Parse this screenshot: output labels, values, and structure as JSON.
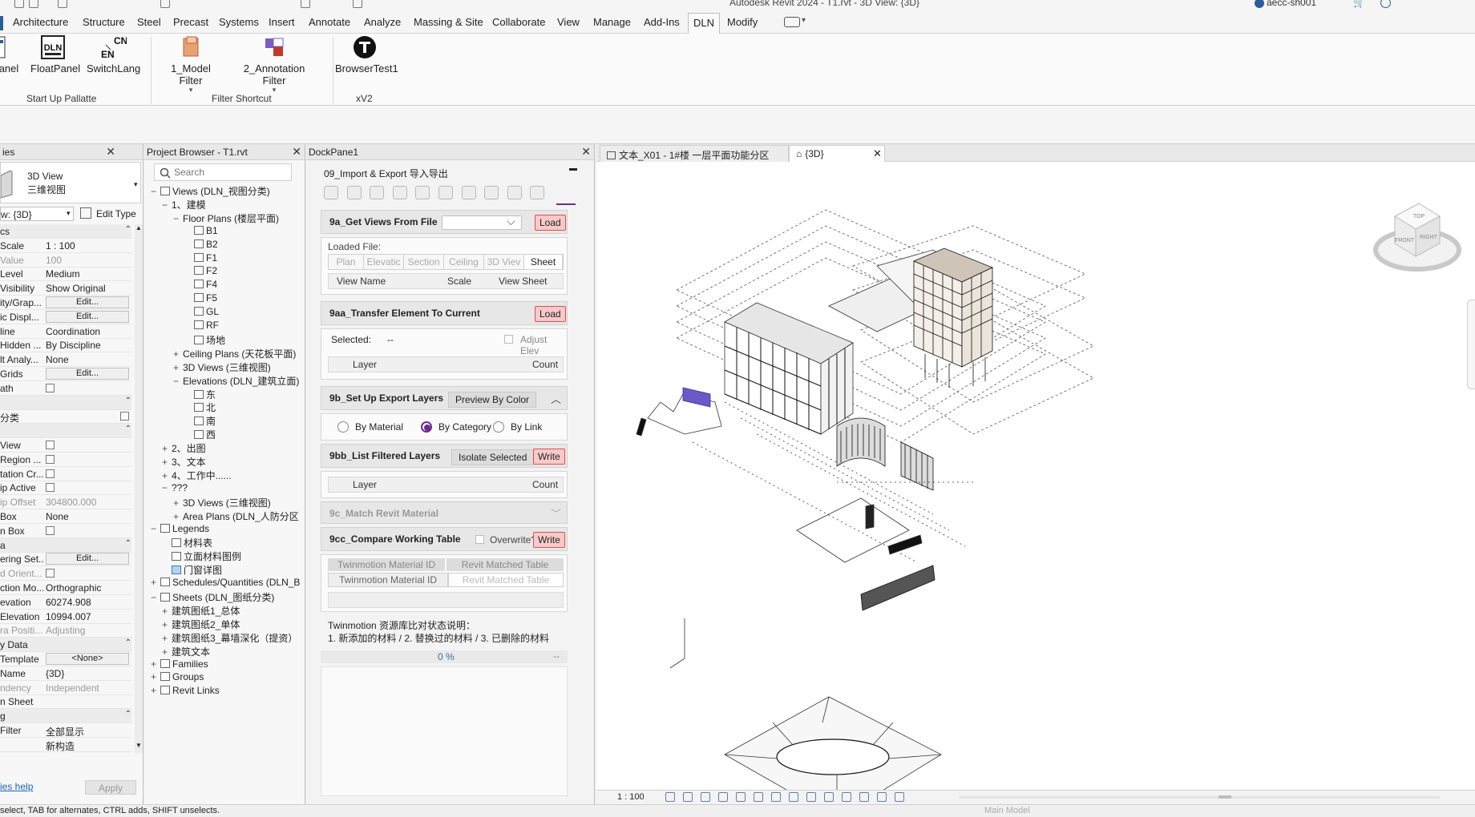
{
  "window": {
    "title": "Autodesk Revit 2024 - T1.rvt - 3D View: {3D}",
    "user": "aecc-sh001"
  },
  "ribbon_tabs": [
    "Architecture",
    "Structure",
    "Steel",
    "Precast",
    "Systems",
    "Insert",
    "Annotate",
    "Analyze",
    "Massing & Site",
    "Collaborate",
    "View",
    "Manage",
    "Add-Ins",
    "DLN",
    "Modify"
  ],
  "active_tab": "DLN",
  "ribbon": {
    "buttons": {
      "panel": "anel",
      "float_panel": "FloatPanel",
      "switch_lang": "SwitchLang",
      "model_filter": "1_Model Filter",
      "annotation_filter": "2_Annotation Filter",
      "browser_test": "BrowserTest1"
    },
    "switch_lang_icon": {
      "cn": "CN",
      "en": "EN"
    },
    "float_panel_icon": "DLN",
    "groups": {
      "startup": "Start Up Pallatte",
      "filter": "Filter Shortcut",
      "xv2": "xV2"
    }
  },
  "properties": {
    "title": "ies",
    "type_name": "3D View",
    "type_name_cn": "三维视图",
    "selector": "w: {3D}",
    "edit_type": "Edit Type",
    "rows": [
      {
        "k": "cs",
        "v": "",
        "group": true
      },
      {
        "k": "Scale",
        "v": "1 : 100"
      },
      {
        "k": "Value",
        "v": "100",
        "grey": true,
        "kv": "1:"
      },
      {
        "k": "Level",
        "v": "Medium"
      },
      {
        "k": "Visibility",
        "v": "Show Original"
      },
      {
        "k": "ity/Grap...",
        "v": "Edit...",
        "btn": true
      },
      {
        "k": "ic Displ...",
        "v": "Edit...",
        "btn": true
      },
      {
        "k": "line",
        "v": "Coordination"
      },
      {
        "k": "Hidden ...",
        "v": "By Discipline"
      },
      {
        "k": "lt Analy...",
        "v": "None"
      },
      {
        "k": "Grids",
        "v": "Edit...",
        "btn": true
      },
      {
        "k": "ath",
        "v": "",
        "cb": true
      },
      {
        "k": "",
        "v": "",
        "group": true
      },
      {
        "k": "分类",
        "v": "",
        "cb2": true
      },
      {
        "k": "",
        "v": "",
        "group": true
      },
      {
        "k": "View",
        "v": "",
        "cb": true
      },
      {
        "k": "Region ...",
        "v": "",
        "cb": true
      },
      {
        "k": "tation Cr...",
        "v": "",
        "cb": true
      },
      {
        "k": "ip Active",
        "v": "",
        "cb": true
      },
      {
        "k": "ip Offset",
        "v": "304800.000",
        "grey": true
      },
      {
        "k": "Box",
        "v": "None"
      },
      {
        "k": "n Box",
        "v": "",
        "cb": true
      },
      {
        "k": "a",
        "v": "",
        "group": true
      },
      {
        "k": "ering Set...",
        "v": "Edit...",
        "btn": true
      },
      {
        "k": "d Orient...",
        "v": "",
        "cb": true,
        "grey": true
      },
      {
        "k": "ction Mo...",
        "v": "Orthographic"
      },
      {
        "k": "evation",
        "v": "60274.908"
      },
      {
        "k": "Elevation",
        "v": "10994.007"
      },
      {
        "k": "ra Positi...",
        "v": "Adjusting",
        "grey": true
      },
      {
        "k": "y Data",
        "v": "",
        "group": true
      },
      {
        "k": "Template",
        "v": "<None>",
        "btn": true
      },
      {
        "k": "Name",
        "v": "{3D}"
      },
      {
        "k": "ndency",
        "v": "Independent",
        "grey": true
      },
      {
        "k": "n Sheet",
        "v": ""
      },
      {
        "k": "g",
        "v": "",
        "group": true
      },
      {
        "k": "Filter",
        "v": "全部显示"
      },
      {
        "k": "",
        "v": "新构造"
      }
    ],
    "help": "ies help",
    "apply": "Apply"
  },
  "browser": {
    "title": "Project Browser - T1.rvt",
    "search_placeholder": "Search",
    "nodes": [
      {
        "t": "Views (DLN_视图分类)",
        "lv": 0,
        "pm": "−",
        "ic": true
      },
      {
        "t": "1、建模",
        "lv": 1,
        "pm": "−"
      },
      {
        "t": "Floor Plans (楼层平面)",
        "lv": 2,
        "pm": "−"
      },
      {
        "t": "B1",
        "lv": 3,
        "vi": true
      },
      {
        "t": "B2",
        "lv": 3,
        "vi": true
      },
      {
        "t": "F1",
        "lv": 3,
        "vi": true
      },
      {
        "t": "F2",
        "lv": 3,
        "vi": true
      },
      {
        "t": "F4",
        "lv": 3,
        "vi": true
      },
      {
        "t": "F5",
        "lv": 3,
        "vi": true
      },
      {
        "t": "GL",
        "lv": 3,
        "vi": true
      },
      {
        "t": "RF",
        "lv": 3,
        "vi": true
      },
      {
        "t": "场地",
        "lv": 3,
        "vi": true
      },
      {
        "t": "Ceiling Plans (天花板平面)",
        "lv": 2,
        "pm": "+"
      },
      {
        "t": "3D Views (三维视图)",
        "lv": 2,
        "pm": "+"
      },
      {
        "t": "Elevations (DLN_建筑立面)",
        "lv": 2,
        "pm": "−"
      },
      {
        "t": "东",
        "lv": 3,
        "vi": true
      },
      {
        "t": "北",
        "lv": 3,
        "vi": true
      },
      {
        "t": "南",
        "lv": 3,
        "vi": true
      },
      {
        "t": "西",
        "lv": 3,
        "vi": true
      },
      {
        "t": "2、出图",
        "lv": 1,
        "pm": "+"
      },
      {
        "t": "3、文本",
        "lv": 1,
        "pm": "+"
      },
      {
        "t": "4、工作中......",
        "lv": 1,
        "pm": "+"
      },
      {
        "t": "???",
        "lv": 1,
        "pm": "−"
      },
      {
        "t": "3D Views (三维视图)",
        "lv": 2,
        "pm": "+"
      },
      {
        "t": "Area Plans (DLN_人防分区",
        "lv": 2,
        "pm": "+"
      },
      {
        "t": "Legends",
        "lv": 0,
        "pm": "−",
        "ic": true
      },
      {
        "t": "材料表",
        "lv": 1,
        "vi": true
      },
      {
        "t": "立面材料图例",
        "lv": 1,
        "vi": true
      },
      {
        "t": "门窗详图",
        "lv": 1,
        "vi": true,
        "sel": true
      },
      {
        "t": "Schedules/Quantities (DLN_B",
        "lv": 0,
        "pm": "+",
        "ic": true
      },
      {
        "t": "Sheets (DLN_图纸分类)",
        "lv": 0,
        "pm": "−",
        "ic": true
      },
      {
        "t": "建筑图纸1_总体",
        "lv": 1,
        "pm": "+"
      },
      {
        "t": "建筑图纸2_单体",
        "lv": 1,
        "pm": "+"
      },
      {
        "t": "建筑图纸3_幕墙深化（提资）",
        "lv": 1,
        "pm": "+"
      },
      {
        "t": "建筑文本",
        "lv": 1,
        "pm": "+"
      },
      {
        "t": "Families",
        "lv": 0,
        "pm": "+",
        "ic": true
      },
      {
        "t": "Groups",
        "lv": 0,
        "pm": "+",
        "ic": true
      },
      {
        "t": "Revit Links",
        "lv": 0,
        "pm": "+",
        "ic": true
      }
    ]
  },
  "dock": {
    "title": "DockPane1",
    "header": "09_Import & Export 导入导出",
    "sec_9a": {
      "title": "9a_Get Views From File",
      "load": "Load"
    },
    "loaded_file": "Loaded File:",
    "view_types": [
      "Plan",
      "Elevatic",
      "Section",
      "Ceiling",
      "3D Viev",
      "Sheet"
    ],
    "view_cols": {
      "name": "View Name",
      "scale": "Scale",
      "sheet": "View Sheet"
    },
    "sec_9aa": {
      "title": "9aa_Transfer Element To Current",
      "load": "Load"
    },
    "selected_label": "Selected:",
    "selected_value": "--",
    "adjust_elev": "Adjust Elev",
    "layer_cols": {
      "layer": "Layer",
      "count": "Count"
    },
    "sec_9b": {
      "title": "9b_Set Up Export Layers",
      "preview": "Preview By Color"
    },
    "radios": {
      "material": "By Material",
      "category": "By Category",
      "link": "By Link"
    },
    "sec_9bb": {
      "title": "9bb_List Filtered Layers",
      "isolate": "Isolate Selected",
      "write": "Write"
    },
    "sec_9c": {
      "title": "9c_Match Revit Material"
    },
    "sec_9cc": {
      "title": "9cc_Compare Working Table",
      "overwrite": "Overwrite?",
      "write": "Write"
    },
    "tm_tabs": [
      "Twinmotion Material ID",
      "Revit Matched Table"
    ],
    "tm_sub": [
      "Twinmotion Material ID",
      "Revit Matched Table"
    ],
    "note1": "Twinmotion 资源库比对状态说明：",
    "note2": "1. 新添加的材料 / 2. 替换过的材料 / 3. 已删除的材料",
    "progress": "0 %",
    "progress_tail": "--"
  },
  "view_tabs": [
    {
      "label": "文本_X01 - 1#楼 一层平面功能分区",
      "active": false
    },
    {
      "label": "{3D}",
      "active": true
    }
  ],
  "viewcube": {
    "top": "TOP",
    "front": "FRONT",
    "right": "RIGHT"
  },
  "viewbar": {
    "scale": "1 : 100"
  },
  "status": {
    "text": "select, TAB for alternates, CTRL adds, SHIFT unselects.",
    "model": "Main Model"
  }
}
